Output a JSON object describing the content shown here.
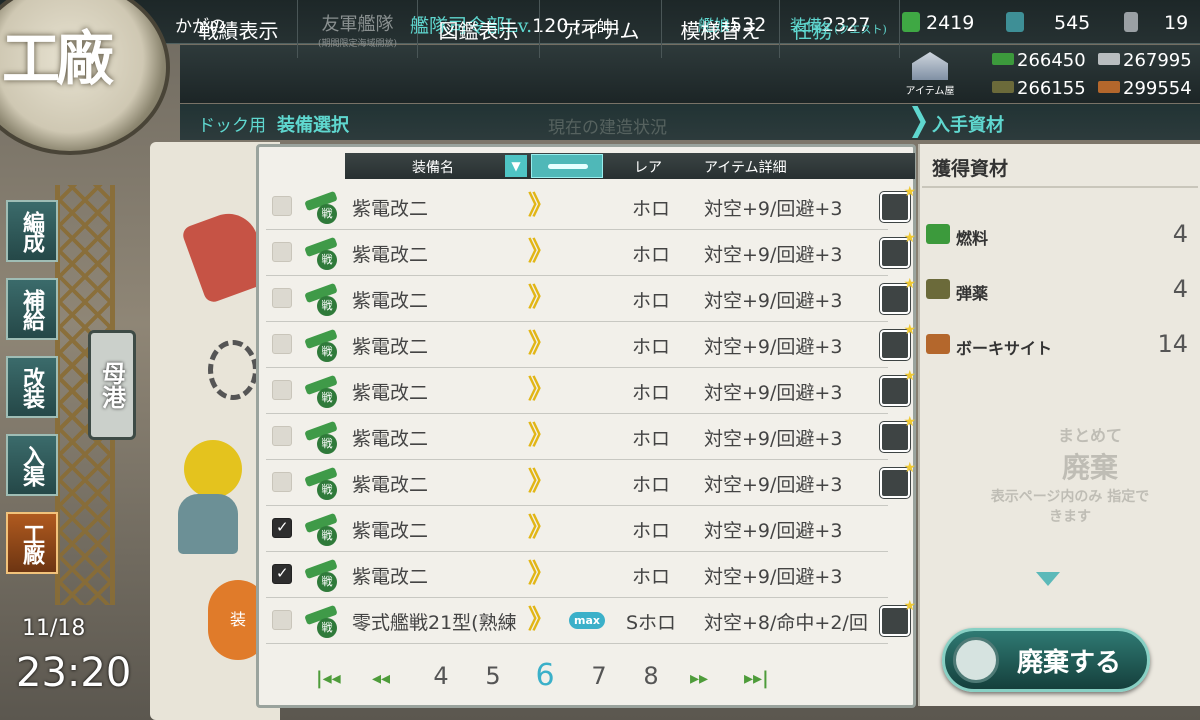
{
  "header": {
    "admiral_name": "かがの",
    "hq_label": "艦隊司令部Lv.",
    "hq_level": "120",
    "rank": "[元帥]",
    "ships_label": "艦娘",
    "ships_count": "532",
    "equip_label": "装備",
    "equip_count": "2327",
    "buckets": "2419",
    "devmat": "545",
    "screws": "19"
  },
  "nav": {
    "items": [
      {
        "label": "戦績表示"
      },
      {
        "label": "友軍艦隊",
        "sub": "(期間限定海域開放)"
      },
      {
        "label": "図鑑表示"
      },
      {
        "label": "アイテム"
      },
      {
        "label": "模様替え"
      },
      {
        "label": "任務",
        "sub": "(クエスト)"
      }
    ],
    "item_shop": "アイテム屋"
  },
  "materials": {
    "fuel": "266450",
    "steel": "267995",
    "ammo": "266155",
    "bauxite": "299554"
  },
  "strip": {
    "dock": "ドック用",
    "title": "装備選択",
    "ghost": "現在の建造状況",
    "right_title": "入手資材"
  },
  "emblem": {
    "label": "工廠"
  },
  "side_menu": {
    "items": [
      "編成",
      "補給",
      "改装",
      "入渠",
      "工廠"
    ],
    "port": "母港"
  },
  "clock": {
    "date": "11/18",
    "time": "23:20"
  },
  "list": {
    "headers": {
      "name": "装備名",
      "sort": "▼",
      "rarity": "レア",
      "detail": "アイテム詳細"
    },
    "rows": [
      {
        "name": "紫電改二",
        "rarity": "ホロ",
        "detail": "対空+9/回避+3",
        "checked": false,
        "locked": true,
        "max": ""
      },
      {
        "name": "紫電改二",
        "rarity": "ホロ",
        "detail": "対空+9/回避+3",
        "checked": false,
        "locked": true,
        "max": ""
      },
      {
        "name": "紫電改二",
        "rarity": "ホロ",
        "detail": "対空+9/回避+3",
        "checked": false,
        "locked": true,
        "max": ""
      },
      {
        "name": "紫電改二",
        "rarity": "ホロ",
        "detail": "対空+9/回避+3",
        "checked": false,
        "locked": true,
        "max": ""
      },
      {
        "name": "紫電改二",
        "rarity": "ホロ",
        "detail": "対空+9/回避+3",
        "checked": false,
        "locked": true,
        "max": ""
      },
      {
        "name": "紫電改二",
        "rarity": "ホロ",
        "detail": "対空+9/回避+3",
        "checked": false,
        "locked": true,
        "max": ""
      },
      {
        "name": "紫電改二",
        "rarity": "ホロ",
        "detail": "対空+9/回避+3",
        "checked": false,
        "locked": true,
        "max": ""
      },
      {
        "name": "紫電改二",
        "rarity": "ホロ",
        "detail": "対空+9/回避+3",
        "checked": true,
        "locked": false,
        "max": ""
      },
      {
        "name": "紫電改二",
        "rarity": "ホロ",
        "detail": "対空+9/回避+3",
        "checked": true,
        "locked": false,
        "max": ""
      },
      {
        "name": "零式艦戦21型(熟練",
        "rarity": "Sホロ",
        "detail": "対空+8/命中+2/回",
        "checked": false,
        "locked": true,
        "max": "max"
      }
    ],
    "type_badge": "戦"
  },
  "pager": {
    "first": "|◂◂",
    "prev": "◂◂",
    "pages": [
      "4",
      "5",
      "6",
      "7",
      "8"
    ],
    "current": "6",
    "next": "▸▸",
    "last": "▸▸|"
  },
  "gained": {
    "title": "獲得資材",
    "items": [
      {
        "name": "燃料",
        "value": "4",
        "color": "#3c9a3c"
      },
      {
        "name": "弾薬",
        "value": "4",
        "color": "#6b6a3a"
      },
      {
        "name": "ボーキサイト",
        "value": "14",
        "color": "#b4672c"
      }
    ],
    "bulk_line1": "まとめて",
    "bulk_line2": "廃棄",
    "bulk_line3": "表示ページ内のみ 指定できます",
    "scrap_button": "廃棄する"
  }
}
